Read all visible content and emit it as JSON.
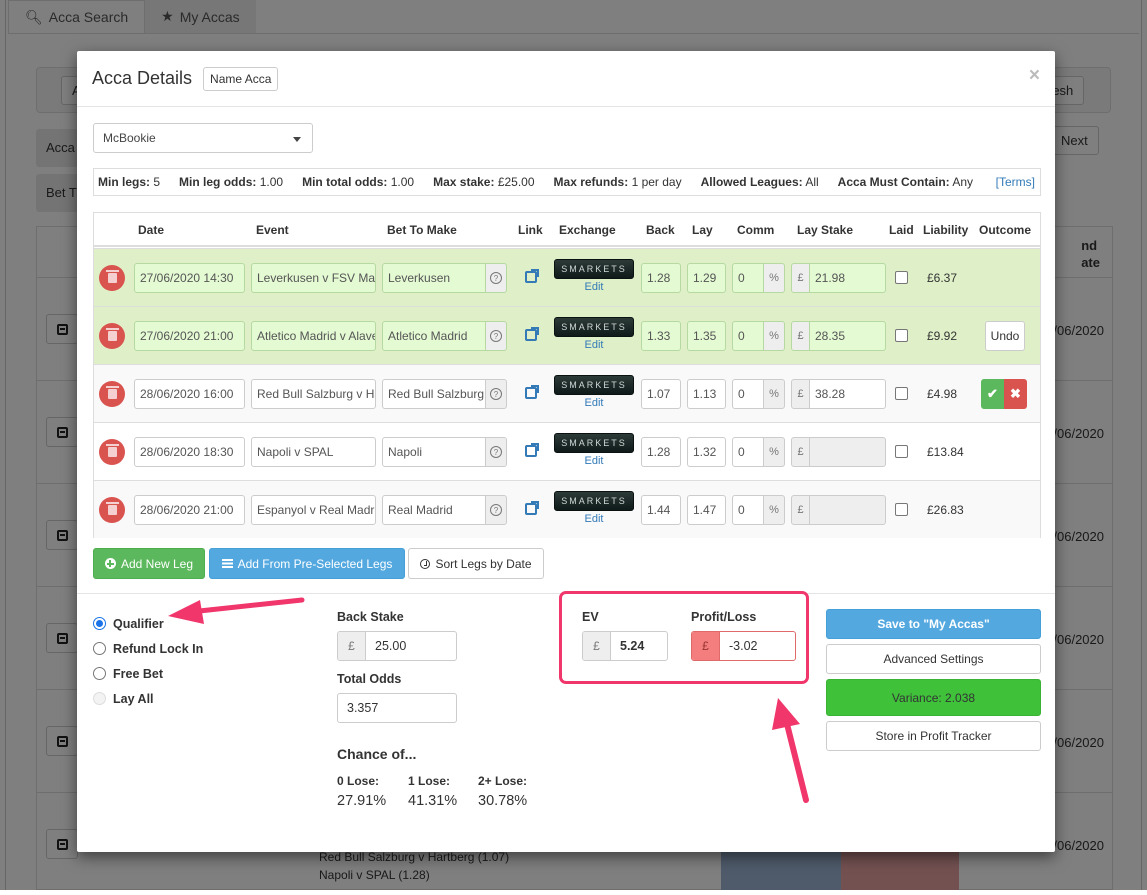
{
  "background": {
    "tabs": [
      {
        "label": "Acca Search",
        "icon": "search-icon"
      },
      {
        "label": "My Accas",
        "icon": "star-icon"
      }
    ],
    "toolbar_left_btn": "A",
    "refresh_label": "resh",
    "next_label": "Next",
    "side_labels": [
      "Acca",
      "Bet T"
    ],
    "column_header": [
      "nd",
      "ate"
    ],
    "row_dates": [
      "/06/2020",
      "/06/2020",
      "/06/2020",
      "/06/2020",
      "/06/2020",
      "/06/2020"
    ],
    "legs_list": [
      "Red Bull Salzburg v Hartberg (1.07)",
      "Napoli v SPAL (1.28)"
    ]
  },
  "modal": {
    "title": "Acca Details",
    "name_acca_label": "Name Acca",
    "close_label": "×",
    "bookmaker": "McBookie",
    "terms": [
      {
        "key": "Min legs:",
        "value": "5"
      },
      {
        "key": "Min leg odds:",
        "value": "1.00"
      },
      {
        "key": "Min total odds:",
        "value": "1.00"
      },
      {
        "key": "Max stake:",
        "value": "£25.00"
      },
      {
        "key": "Max refunds:",
        "value": "1 per day"
      },
      {
        "key": "Allowed Leagues:",
        "value": "All"
      },
      {
        "key": "Acca Must Contain:",
        "value": "Any"
      }
    ],
    "terms_link": "[Terms]",
    "columns": [
      "Date",
      "Event",
      "Bet To Make",
      "Link",
      "Exchange",
      "Back",
      "Lay",
      "Comm",
      "Lay Stake",
      "Laid",
      "Liability",
      "Outcome"
    ],
    "exchange_logo": "SMARKETS",
    "edit_label": "Edit",
    "comm_suffix": "%",
    "currency": "£",
    "legs": [
      {
        "date": "27/06/2020 14:30",
        "event": "Leverkusen v FSV Mainz",
        "bet": "Leverkusen",
        "back": "1.28",
        "lay": "1.29",
        "comm": "0",
        "lay_stake": "21.98",
        "laid": false,
        "liability": "£6.37",
        "outcome": "won",
        "outcome_label": ""
      },
      {
        "date": "27/06/2020 21:00",
        "event": "Atletico Madrid v Alaves",
        "bet": "Atletico Madrid",
        "back": "1.33",
        "lay": "1.35",
        "comm": "0",
        "lay_stake": "28.35",
        "laid": false,
        "liability": "£9.92",
        "outcome": "won",
        "outcome_label": "Undo"
      },
      {
        "date": "28/06/2020 16:00",
        "event": "Red Bull Salzburg v Hartberg",
        "bet": "Red Bull Salzburg",
        "back": "1.07",
        "lay": "1.13",
        "comm": "0",
        "lay_stake": "38.28",
        "laid": false,
        "liability": "£4.98",
        "outcome": "pending",
        "outcome_label": ""
      },
      {
        "date": "28/06/2020 18:30",
        "event": "Napoli v SPAL",
        "bet": "Napoli",
        "back": "1.28",
        "lay": "1.32",
        "comm": "0",
        "lay_stake": "",
        "laid": false,
        "liability": "£13.84",
        "outcome": "none",
        "outcome_label": ""
      },
      {
        "date": "28/06/2020 21:00",
        "event": "Espanyol v Real Madrid",
        "bet": "Real Madrid",
        "back": "1.44",
        "lay": "1.47",
        "comm": "0",
        "lay_stake": "",
        "laid": false,
        "liability": "£26.83",
        "outcome": "none",
        "outcome_label": ""
      }
    ],
    "buttons": {
      "add_new_leg": "Add New Leg",
      "add_preselected": "Add From Pre-Selected Legs",
      "sort_by_date": "Sort Legs by Date"
    },
    "bet_types": [
      {
        "label": "Qualifier",
        "selected": true,
        "disabled": false
      },
      {
        "label": "Refund Lock In",
        "selected": false,
        "disabled": false
      },
      {
        "label": "Free Bet",
        "selected": false,
        "disabled": false
      },
      {
        "label": "Lay All",
        "selected": false,
        "disabled": true
      }
    ],
    "back_stake_label": "Back Stake",
    "back_stake": "25.00",
    "total_odds_label": "Total Odds",
    "total_odds": "3.357",
    "chance_title": "Chance of...",
    "chances": [
      {
        "label": "0 Lose:",
        "value": "27.91%"
      },
      {
        "label": "1 Lose:",
        "value": "41.31%"
      },
      {
        "label": "2+ Lose:",
        "value": "30.78%"
      }
    ],
    "ev_label": "EV",
    "ev_value": "5.24",
    "pl_label": "Profit/Loss",
    "pl_value": "-3.02",
    "save_label": "Save to \"My Accas\"",
    "advanced_label": "Advanced Settings",
    "variance_label": "Variance: 2.038",
    "store_label": "Store in Profit Tracker"
  },
  "colors": {
    "highlight": "#f0366b",
    "leg_won_bg": "#dff0c8",
    "variance_green": "#3fc23a",
    "profit_negative": "#f47e7e"
  }
}
